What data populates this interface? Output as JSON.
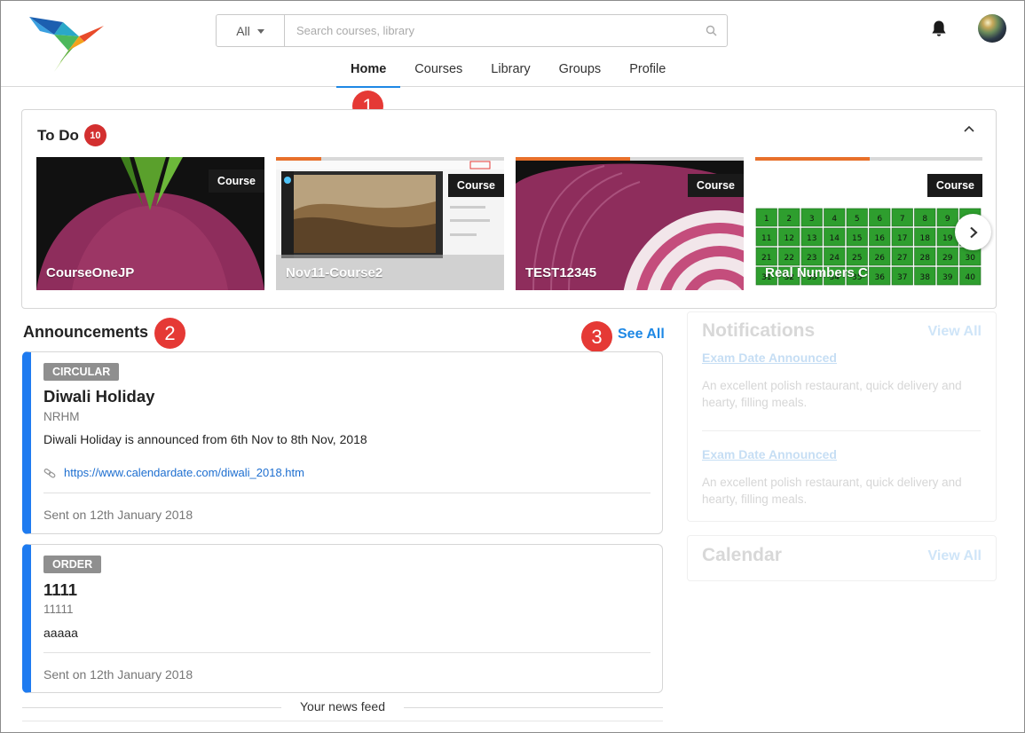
{
  "header": {
    "search_filter": "All",
    "search_placeholder": "Search courses, library",
    "nav": [
      "Home",
      "Courses",
      "Library",
      "Groups",
      "Profile"
    ],
    "active_nav": "Home"
  },
  "markers": [
    "1",
    "2",
    "3"
  ],
  "todo": {
    "title": "To Do",
    "count": "10",
    "cards": [
      {
        "title": "CourseOneJP",
        "badge": "Course",
        "progress": null
      },
      {
        "title": "Nov11-Course2",
        "badge": "Course",
        "progress": 0.2
      },
      {
        "title": "TEST12345",
        "badge": "Course",
        "progress": 0.5
      },
      {
        "title": "Real Numbers C",
        "badge": "Course",
        "progress": 0.5
      }
    ]
  },
  "announcements": {
    "title": "Announcements",
    "see_all": "See All",
    "items": [
      {
        "tag": "CIRCULAR",
        "title": "Diwali Holiday",
        "sub": "NRHM",
        "body": "Diwali Holiday is announced from 6th Nov to 8th Nov, 2018",
        "link": "https://www.calendardate.com/diwali_2018.htm",
        "footer": "Sent on 12th January 2018"
      },
      {
        "tag": "ORDER",
        "title": "1111",
        "sub": "11111",
        "body": "aaaaa",
        "footer": "Sent on 12th January 2018"
      }
    ],
    "feed_label": "Your news feed"
  },
  "notifications": {
    "title": "Notifications",
    "view_all": "View All",
    "items": [
      {
        "title": "Exam Date Announced",
        "text": "An excellent polish restaurant, quick delivery and hearty, filling meals."
      },
      {
        "title": "Exam Date Announced",
        "text": "An excellent polish restaurant, quick delivery and hearty, filling meals."
      }
    ]
  },
  "calendar": {
    "title": "Calendar",
    "view_all": "View All"
  },
  "colors": {
    "accent": "#1e88e5",
    "announcement_bar": "#1e7bf0",
    "badge": "#d32f2f",
    "marker": "#e53935",
    "progress": "#e8702a"
  }
}
